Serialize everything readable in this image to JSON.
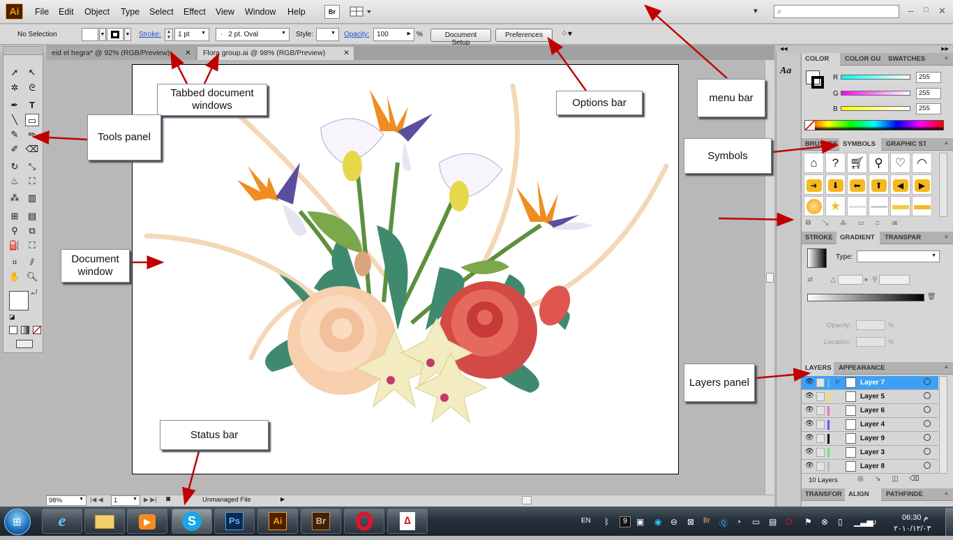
{
  "app": {
    "logo": "Ai"
  },
  "menu": [
    "File",
    "Edit",
    "Object",
    "Type",
    "Select",
    "Effect",
    "View",
    "Window",
    "Help"
  ],
  "menu_bridge": "Br",
  "options_bar": {
    "selection": "No Selection",
    "stroke_label": "Stroke:",
    "stroke_weight": "1 pt",
    "brush": "2 pt. Oval",
    "style_label": "Style:",
    "opacity_label": "Opacity:",
    "opacity_value": "100",
    "opacity_unit": "%",
    "document_setup": "Document Setup",
    "preferences": "Preferences"
  },
  "tabs": [
    {
      "label": "eid el hegra* @ 92% (RGB/Preview)"
    },
    {
      "label": "Flora group.ai @ 98% (RGB/Preview)"
    }
  ],
  "status": {
    "zoom": "98%",
    "page": "1",
    "file_status": "Unmanaged File"
  },
  "color_panel": {
    "tabs": [
      "COLOR",
      "COLOR GU",
      "SWATCHES"
    ],
    "r_label": "R",
    "g_label": "G",
    "b_label": "B",
    "r": "255",
    "g": "255",
    "b": "255"
  },
  "symbols_panel": {
    "tabs": [
      "BRUSHES",
      "SYMBOLS",
      "GRAPHIC ST"
    ],
    "icons": [
      "house-icon",
      "help-icon",
      "cart-icon",
      "search-icon",
      "heart-icon",
      "rss-icon",
      "arrow-right-icon",
      "arrow-down-icon",
      "arrow-left-icon",
      "arrow-up-icon",
      "arrow-left-icon",
      "arrow-right-icon",
      "globe-icon",
      "star-icon",
      "bar-icon",
      "bar-icon",
      "bar-icon",
      "bar-icon"
    ]
  },
  "gradient_panel": {
    "tabs": [
      "STROKE",
      "GRADIENT",
      "TRANSPAR"
    ],
    "type_label": "Type:",
    "opacity_label": "Opacity:",
    "location_label": "Location:",
    "percent": "%"
  },
  "layers_panel": {
    "tabs": [
      "LAYERS",
      "APPEARANCE"
    ],
    "layers": [
      {
        "name": "Layer 7",
        "color": "#4fc3f7",
        "selected": true
      },
      {
        "name": "Layer 5",
        "color": "#f5e642"
      },
      {
        "name": "Layer 6",
        "color": "#ff66cc"
      },
      {
        "name": "Layer 4",
        "color": "#5a5aff"
      },
      {
        "name": "Layer 9",
        "color": "#111111"
      },
      {
        "name": "Layer 3",
        "color": "#66ee66"
      },
      {
        "name": "Layer 8",
        "color": "#bbbbbb"
      }
    ],
    "count": "10 Layers"
  },
  "bottom_panel_tabs": [
    "TRANSFOR",
    "ALIGN",
    "PATHFINDE"
  ],
  "callouts": {
    "tabbed": "Tabbed document windows",
    "options": "Options bar",
    "menu": "menu bar",
    "tools": "Tools panel",
    "symbols": "Symbols",
    "document": "Document window",
    "layers": "Layers panel",
    "status": "Status bar"
  },
  "taskbar": {
    "apps": [
      "Ps",
      "Ai",
      "Br"
    ],
    "lang": "EN",
    "time": "06:30 م",
    "date": "٢٠١٠/١٢/٠٣",
    "tray_nine": "9"
  },
  "colors": {
    "selected_layer": "#3ea0f5",
    "arrow": "#c00000"
  }
}
